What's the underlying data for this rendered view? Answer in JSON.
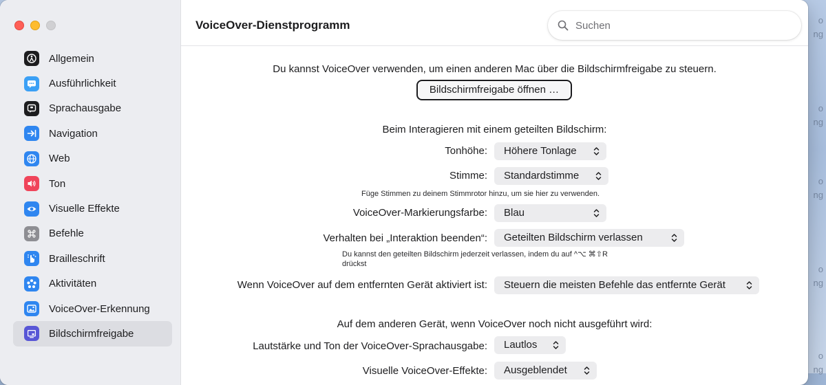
{
  "window": {
    "title": "VoiceOver-Dienstprogramm"
  },
  "search": {
    "placeholder": "Suchen"
  },
  "sidebar": {
    "items": [
      {
        "label": "Allgemein",
        "icon": "general-icon",
        "color": "#1d1d1f"
      },
      {
        "label": "Ausführlichkeit",
        "icon": "speech-bubble-icon",
        "color": "#3ba0f5"
      },
      {
        "label": "Sprachausgabe",
        "icon": "speech-icon",
        "color": "#1d1d1f"
      },
      {
        "label": "Navigation",
        "icon": "arrow-tab-icon",
        "color": "#2f86f0"
      },
      {
        "label": "Web",
        "icon": "globe-icon",
        "color": "#2f86f0"
      },
      {
        "label": "Ton",
        "icon": "speaker-icon",
        "color": "#f0445a"
      },
      {
        "label": "Visuelle Effekte",
        "icon": "eye-icon",
        "color": "#2f86f0"
      },
      {
        "label": "Befehle",
        "icon": "command-icon",
        "color": "#8e8e93"
      },
      {
        "label": "Brailleschrift",
        "icon": "braille-hand-icon",
        "color": "#2f86f0"
      },
      {
        "label": "Aktivitäten",
        "icon": "activities-icon",
        "color": "#2f86f0"
      },
      {
        "label": "VoiceOver-Erkennung",
        "icon": "recognition-icon",
        "color": "#2f86f0"
      },
      {
        "label": "Bildschirmfreigabe",
        "icon": "screen-sharing-icon",
        "color": "#5856d6",
        "selected": true
      }
    ]
  },
  "main": {
    "intro": "Du kannst VoiceOver verwenden, um einen anderen Mac über die Bildschirmfreigabe zu steuern.",
    "open_button": "Bildschirmfreigabe öffnen …",
    "section1_heading": "Beim Interagieren mit einem geteilten Bildschirm:",
    "pitch_label": "Tonhöhe:",
    "pitch_value": "Höhere Tonlage",
    "voice_label": "Stimme:",
    "voice_value": "Standardstimme",
    "voice_hint": "Füge Stimmen zu deinem Stimmrotor hinzu, um sie hier zu verwenden.",
    "cursor_color_label": "VoiceOver-Markierungsfarbe:",
    "cursor_color_value": "Blau",
    "end_interaction_label": "Verhalten bei „Interaktion beenden“:",
    "end_interaction_value": "Geteilten Bildschirm verlassen",
    "end_interaction_hint_1": "Du kannst den geteilten Bildschirm jederzeit verlassen, indem du auf ^⌥ ⌘⇧R",
    "end_interaction_hint_2": "drückst",
    "remote_active_label": "Wenn VoiceOver auf dem entfernten Gerät aktiviert ist:",
    "remote_active_value": "Steuern die meisten Befehle das entfernte Gerät",
    "section2_heading": "Auf dem anderen Gerät, wenn VoiceOver noch nicht ausgeführt wird:",
    "volume_label": "Lautstärke und Ton der VoiceOver-Sprachausgabe:",
    "volume_value": "Lautlos",
    "visual_label": "Visuelle VoiceOver-Effekte:",
    "visual_value": "Ausgeblendet"
  },
  "desktop": {
    "labels": [
      "o",
      "ng",
      "o",
      "ng",
      "o",
      "ng",
      "o",
      "ng",
      "o",
      "ng"
    ]
  }
}
